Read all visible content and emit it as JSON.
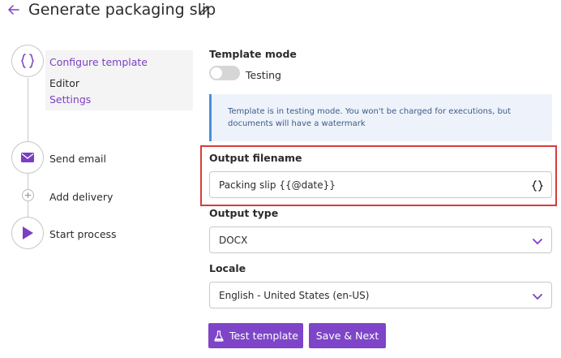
{
  "header": {
    "title": "Generate packaging slip",
    "back_icon": "arrow-left-icon",
    "edit_icon": "pencil-icon"
  },
  "stepper": {
    "steps": [
      {
        "label": "Configure template",
        "icon": "curly-braces-icon",
        "active": true,
        "substeps": [
          {
            "label": "Editor"
          },
          {
            "label": "Settings"
          }
        ]
      },
      {
        "label": "Send email",
        "icon": "envelope-icon"
      },
      {
        "label": "Add delivery",
        "icon": "plus-circle-icon"
      },
      {
        "label": "Start process",
        "icon": "play-icon"
      }
    ]
  },
  "form": {
    "template_mode": {
      "label": "Template mode",
      "toggle_label": "Testing",
      "enabled": false
    },
    "info": {
      "text": "Template is in testing mode. You won't be charged for executions, but documents will have a watermark"
    },
    "output_filename": {
      "label": "Output filename",
      "value": "Packing slip {{@date}}",
      "icon": "curly-braces-icon"
    },
    "output_type": {
      "label": "Output type",
      "value": "DOCX",
      "icon": "chevron-down-icon"
    },
    "locale": {
      "label": "Locale",
      "value": "English - United States (en-US)",
      "icon": "chevron-down-icon"
    }
  },
  "actions": {
    "test_label": "Test template",
    "test_icon": "flask-icon",
    "save_label": "Save & Next"
  },
  "colors": {
    "accent": "#7e45c9",
    "highlight": "#d93b3b",
    "info_border": "#4a90d9"
  }
}
